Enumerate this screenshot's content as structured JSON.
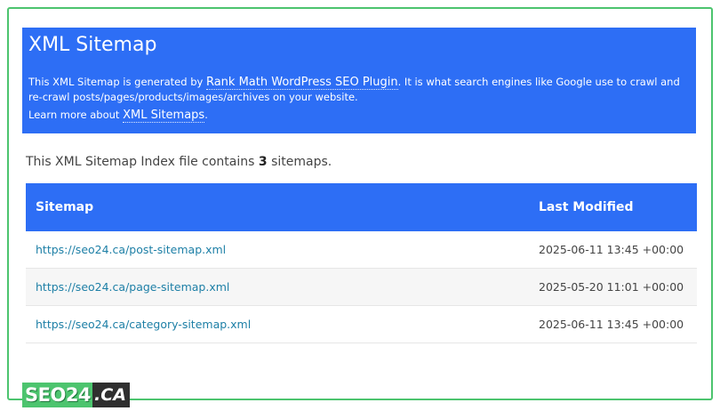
{
  "header": {
    "title": "XML Sitemap",
    "intro_before": "This XML Sitemap is generated by ",
    "intro_link": "Rank Math WordPress SEO Plugin",
    "intro_after": ". It is what search engines like Google use to crawl and re-crawl posts/pages/products/images/archives on your website.",
    "learn_before": "Learn more about ",
    "learn_link": "XML Sitemaps",
    "learn_after": "."
  },
  "summary": {
    "before": "This XML Sitemap Index file contains ",
    "count": "3",
    "after": " sitemaps."
  },
  "table": {
    "headers": [
      "Sitemap",
      "Last Modified"
    ],
    "rows": [
      {
        "url": "https://seo24.ca/post-sitemap.xml",
        "modified": "2025-06-11 13:45 +00:00"
      },
      {
        "url": "https://seo24.ca/page-sitemap.xml",
        "modified": "2025-05-20 11:01 +00:00"
      },
      {
        "url": "https://seo24.ca/category-sitemap.xml",
        "modified": "2025-06-11 13:45 +00:00"
      }
    ]
  },
  "logo": {
    "part1": "SEO24",
    "part2": ".CA"
  },
  "colors": {
    "header_bg": "#2d6ef5",
    "frame_border": "#4cc46e",
    "link": "#1d7fa6"
  }
}
